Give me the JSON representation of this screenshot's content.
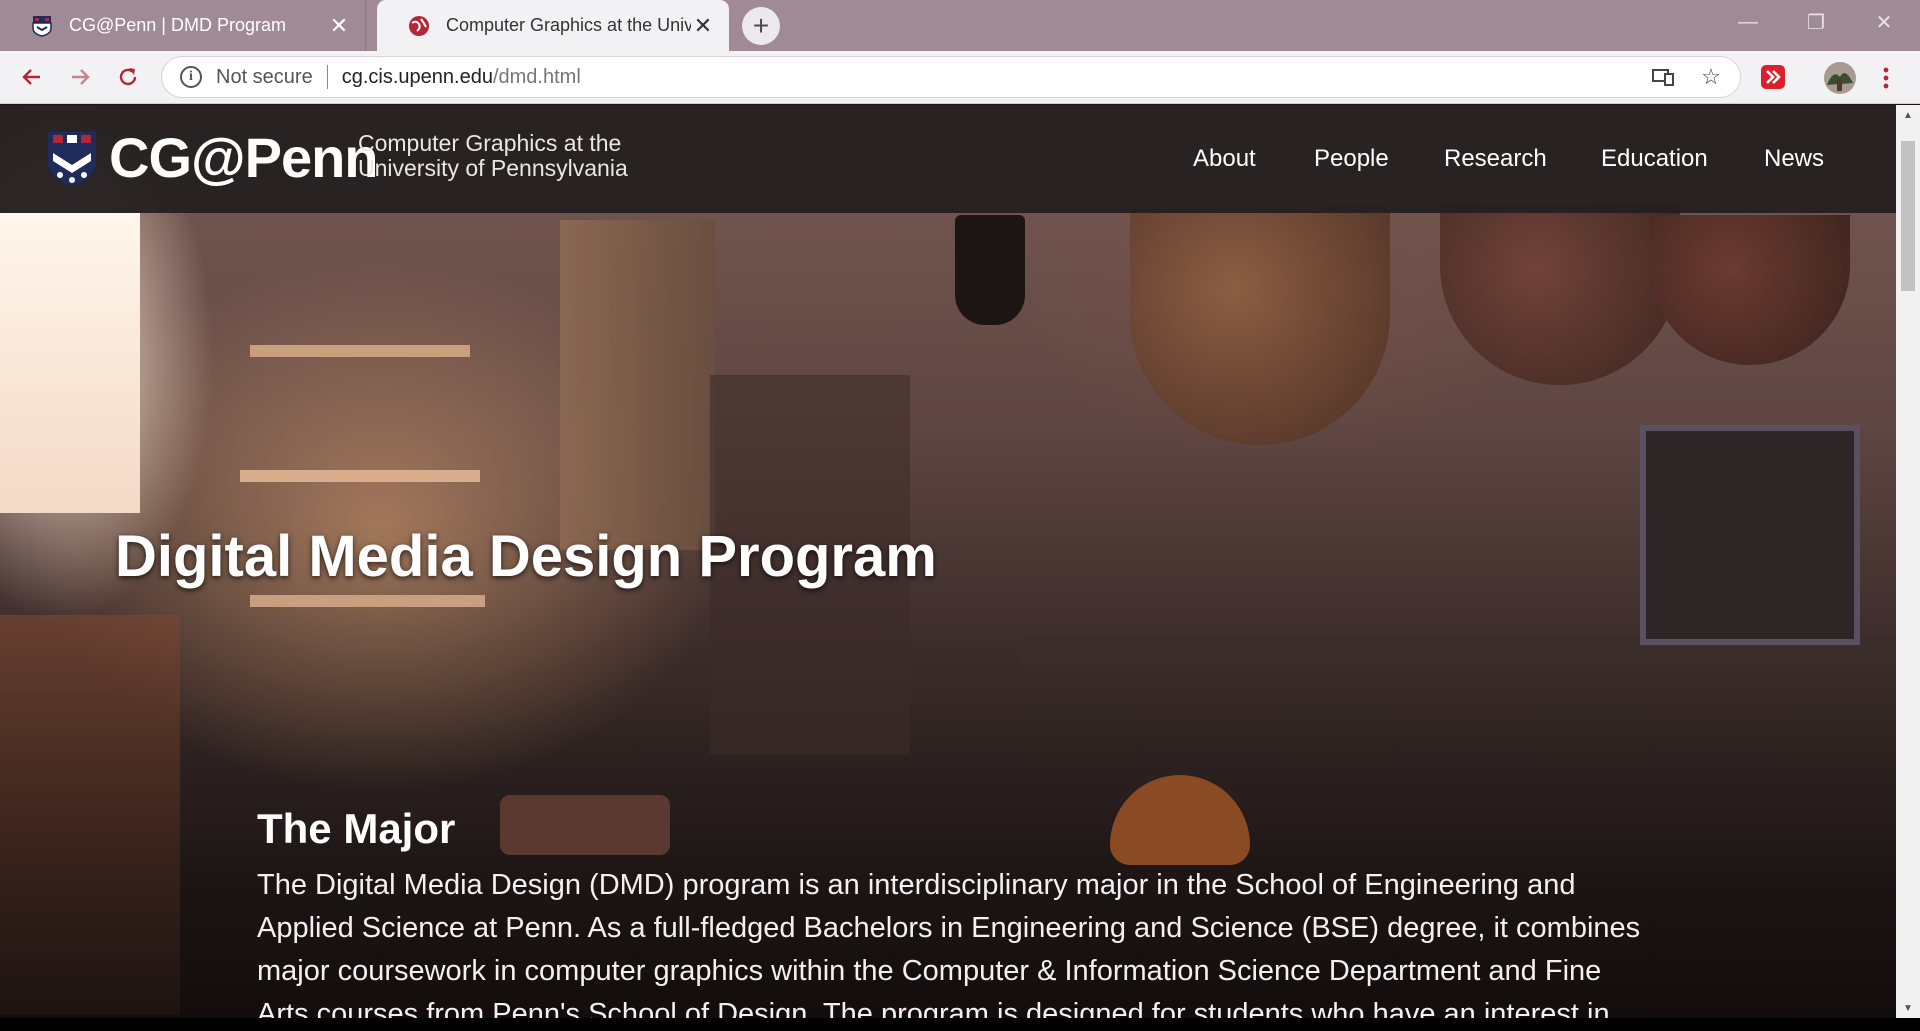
{
  "browser": {
    "tabs": [
      {
        "title": "CG@Penn | DMD Program",
        "active": false
      },
      {
        "title": "Computer Graphics at the University",
        "active": true
      }
    ],
    "new_tab_glyph": "+",
    "close_glyph": "✕",
    "window_controls": {
      "minimize": "—",
      "restore": "❐",
      "close": "✕"
    },
    "address": {
      "security_label": "Not secure",
      "host": "cg.cis.upenn.edu",
      "path": "/dmd.html"
    },
    "accent_color": "#b52738"
  },
  "site": {
    "logo_text": "CG@Penn",
    "logo_subtitle_line1": "Computer Graphics at the",
    "logo_subtitle_line2": "University of Pennsylvania",
    "nav": [
      "About",
      "People",
      "Research",
      "Education",
      "News"
    ]
  },
  "hero": {
    "title": "Digital Media Design Program"
  },
  "section": {
    "title": "The Major",
    "body": "The Digital Media Design (DMD) program is an interdisciplinary major in the School of Engineering and Applied Science at Penn. As a full-fledged Bachelors in Engineering and Science (BSE) degree, it combines major coursework in computer graphics within the Computer & Information Science Department and Fine Arts courses from Penn's School of Design. The program is designed for students who have an interest in the"
  }
}
